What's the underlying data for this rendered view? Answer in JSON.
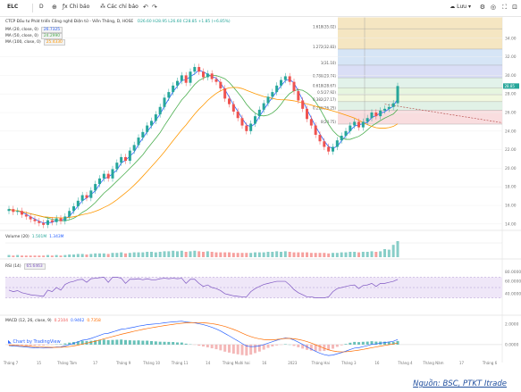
{
  "toolbar": {
    "symbol": "ELC",
    "interval": "D",
    "compare_icon": "compare-icon",
    "indicators_label": "Chỉ báo",
    "templates_label": "Các chỉ báo",
    "undo_icon": "undo-icon",
    "redo_icon": "redo-icon",
    "save_label": "Lưu",
    "icons": [
      "settings-icon",
      "camera-icon",
      "fullscreen-icon",
      "snapshot-icon"
    ]
  },
  "legend": {
    "title": "CTCP Đầu tư Phát triển Công nghệ Điện tử - Viễn Thông, D, HOSE",
    "ohlc": "O26.60  H28.95  L26.60  C28.85  +1.85 (+6.85%)",
    "ma_rows": [
      {
        "label": "MA (20, close, 0)",
        "value": "26.7325",
        "color": "#2962ff"
      },
      {
        "label": "MA (50, close, 0)",
        "value": "24.2990",
        "color": "#4caf50"
      },
      {
        "label": "MA (100, close, 0)",
        "value": "25.4330",
        "color": "#ff9800"
      }
    ],
    "volume_label": "Volume (20)",
    "volume_values": [
      "1.501M",
      "1.343M"
    ],
    "rsi_label": "RSI (14)",
    "rsi_value": "65.6463",
    "macd_label": "MACD (12, 26, close, 9)",
    "macd_values": [
      "0.2104",
      "0.9462",
      "0.7358"
    ]
  },
  "watermark": "Chart by TradingView",
  "source": "Nguồn: BSC, PTKT Itrade",
  "colors": {
    "up": "#26a69a",
    "down": "#ef5350",
    "ma20": "#2962ff",
    "ma50": "#4caf50",
    "ma100": "#ff9800",
    "rsi": "#7e57c2"
  },
  "chart_data": {
    "type": "candlestick",
    "ylim": [
      13.5,
      36
    ],
    "price_ticks": [
      "34.00",
      "32.00",
      "30.00",
      "28.00",
      "26.00",
      "24.00",
      "22.00",
      "20.00",
      "18.00",
      "16.00",
      "14.00"
    ],
    "last_price": "28.85",
    "fib_levels": [
      {
        "label": "1.618(35.02)",
        "value": 35.02
      },
      {
        "label": "1.272(32.83)",
        "value": 32.83
      },
      {
        "label": "1(31.10)",
        "value": 31.1
      },
      {
        "label": "0.786(29.74)",
        "value": 29.74
      },
      {
        "label": "0.618(28.67)",
        "value": 28.67
      },
      {
        "label": "0.5(27.92)",
        "value": 27.92
      },
      {
        "label": "0.382(27.17)",
        "value": 27.17
      },
      {
        "label": "0.236(26.25)",
        "value": 26.25
      },
      {
        "label": "0(24.75)",
        "value": 24.75
      }
    ],
    "x_labels": [
      "Tháng 7",
      "15",
      "Tháng Tám",
      "17",
      "Tháng 9",
      "Tháng 10",
      "Tháng 11",
      "14",
      "Tháng Mười hai",
      "16",
      "2023",
      "Tháng Hai",
      "Tháng 3",
      "16",
      "Tháng 4",
      "Tháng Năm",
      "17",
      "Tháng 6"
    ],
    "close": [
      15.6,
      15.3,
      15.4,
      15.0,
      14.8,
      14.5,
      14.3,
      14.1,
      13.9,
      14.4,
      14.2,
      14.6,
      14.3,
      14.8,
      15.4,
      15.9,
      16.5,
      17.1,
      16.8,
      17.6,
      18.3,
      18.9,
      19.4,
      18.9,
      19.9,
      20.6,
      21.2,
      20.8,
      21.9,
      22.5,
      23.3,
      23.9,
      24.6,
      25.1,
      25.8,
      26.6,
      27.6,
      28.2,
      28.9,
      29.4,
      30.0,
      29.2,
      30.4,
      30.9,
      30.4,
      29.8,
      30.2,
      29.6,
      29.3,
      28.6,
      27.5,
      26.9,
      26.1,
      25.4,
      24.6,
      24.0,
      24.8,
      25.6,
      26.3,
      27.0,
      27.7,
      28.2,
      28.9,
      29.5,
      29.9,
      29.3,
      28.3,
      27.3,
      26.4,
      25.3,
      24.6,
      23.6,
      22.9,
      22.3,
      21.8,
      22.3,
      23.0,
      23.5,
      24.0,
      24.6,
      25.0,
      24.4,
      25.0,
      25.4,
      26.0,
      25.6,
      26.2,
      26.4,
      26.6,
      27.0,
      28.85
    ],
    "volume": [
      0.4,
      0.3,
      0.4,
      0.3,
      0.3,
      0.3,
      0.3,
      0.3,
      0.3,
      0.4,
      0.3,
      0.4,
      0.3,
      0.4,
      0.5,
      0.5,
      0.6,
      0.6,
      0.5,
      0.6,
      0.7,
      0.7,
      0.7,
      0.6,
      0.8,
      0.8,
      0.9,
      0.7,
      0.8,
      0.9,
      0.9,
      0.9,
      1.0,
      1.0,
      0.9,
      1.0,
      1.1,
      1.1,
      1.2,
      1.1,
      1.2,
      1.0,
      1.1,
      1.2,
      1.1,
      1.0,
      1.1,
      1.0,
      0.9,
      0.9,
      0.9,
      0.9,
      0.8,
      0.8,
      0.8,
      0.8,
      0.8,
      0.9,
      0.9,
      0.9,
      1.0,
      1.0,
      1.1,
      1.0,
      1.1,
      1.0,
      0.9,
      0.9,
      0.9,
      0.9,
      0.8,
      0.8,
      0.8,
      0.8,
      0.7,
      0.8,
      0.8,
      0.9,
      0.9,
      1.0,
      1.0,
      0.9,
      1.0,
      1.0,
      1.1,
      1.0,
      1.1,
      1.5,
      1.4,
      2.3,
      3.0
    ],
    "rsi": [
      45,
      42,
      44,
      40,
      38,
      36,
      35,
      34,
      33,
      45,
      42,
      50,
      45,
      56,
      60,
      62,
      65,
      66,
      60,
      67,
      68,
      69,
      70,
      60,
      70,
      70,
      68,
      58,
      66,
      66,
      67,
      65,
      67,
      65,
      65,
      67,
      68,
      67,
      68,
      67,
      68,
      58,
      66,
      66,
      58,
      52,
      55,
      50,
      48,
      44,
      38,
      36,
      34,
      33,
      32,
      32,
      42,
      48,
      52,
      56,
      58,
      60,
      62,
      62,
      62,
      55,
      46,
      40,
      36,
      32,
      32,
      30,
      30,
      30,
      32,
      42,
      48,
      50,
      52,
      54,
      55,
      48,
      54,
      55,
      58,
      52,
      58,
      58,
      60,
      62,
      65.6
    ],
    "macd": [
      -0.1,
      -0.14,
      -0.16,
      -0.2,
      -0.24,
      -0.28,
      -0.31,
      -0.33,
      -0.34,
      -0.3,
      -0.3,
      -0.24,
      -0.22,
      -0.13,
      0.0,
      0.12,
      0.27,
      0.43,
      0.48,
      0.6,
      0.75,
      0.9,
      1.05,
      1.1,
      1.23,
      1.36,
      1.49,
      1.54,
      1.62,
      1.7,
      1.8,
      1.86,
      1.94,
      1.98,
      2.02,
      2.06,
      2.12,
      2.17,
      2.22,
      2.24,
      2.28,
      2.2,
      2.16,
      2.12,
      2.03,
      1.94,
      1.82,
      1.68,
      1.52,
      1.32,
      1.08,
      0.85,
      0.6,
      0.36,
      0.1,
      -0.14,
      -0.2,
      -0.18,
      -0.12,
      0.0,
      0.14,
      0.28,
      0.42,
      0.54,
      0.64,
      0.6,
      0.44,
      0.24,
      0.02,
      -0.22,
      -0.44,
      -0.66,
      -0.84,
      -0.98,
      -1.06,
      -1.02,
      -0.9,
      -0.78,
      -0.64,
      -0.48,
      -0.34,
      -0.3,
      -0.2,
      -0.1,
      0.02,
      0.06,
      0.14,
      0.2,
      0.26,
      0.32,
      0.5
    ],
    "signal": [
      -0.05,
      -0.07,
      -0.09,
      -0.11,
      -0.14,
      -0.17,
      -0.2,
      -0.23,
      -0.25,
      -0.26,
      -0.27,
      -0.27,
      -0.26,
      -0.24,
      -0.19,
      -0.13,
      -0.05,
      0.05,
      0.14,
      0.23,
      0.33,
      0.44,
      0.56,
      0.67,
      0.78,
      0.89,
      1.0,
      1.1,
      1.2,
      1.3,
      1.39,
      1.48,
      1.56,
      1.64,
      1.71,
      1.78,
      1.85,
      1.91,
      1.97,
      2.03,
      2.08,
      2.11,
      2.13,
      2.14,
      2.14,
      2.12,
      2.09,
      2.04,
      1.97,
      1.88,
      1.77,
      1.63,
      1.48,
      1.31,
      1.12,
      0.93,
      0.78,
      0.65,
      0.56,
      0.49,
      0.46,
      0.46,
      0.5,
      0.55,
      0.6,
      0.6,
      0.57,
      0.5,
      0.41,
      0.29,
      0.15,
      -0.02,
      -0.19,
      -0.36,
      -0.51,
      -0.62,
      -0.68,
      -0.71,
      -0.7,
      -0.66,
      -0.6,
      -0.54,
      -0.47,
      -0.39,
      -0.31,
      -0.23,
      -0.15,
      -0.08,
      -0.01,
      0.06,
      0.15
    ]
  }
}
